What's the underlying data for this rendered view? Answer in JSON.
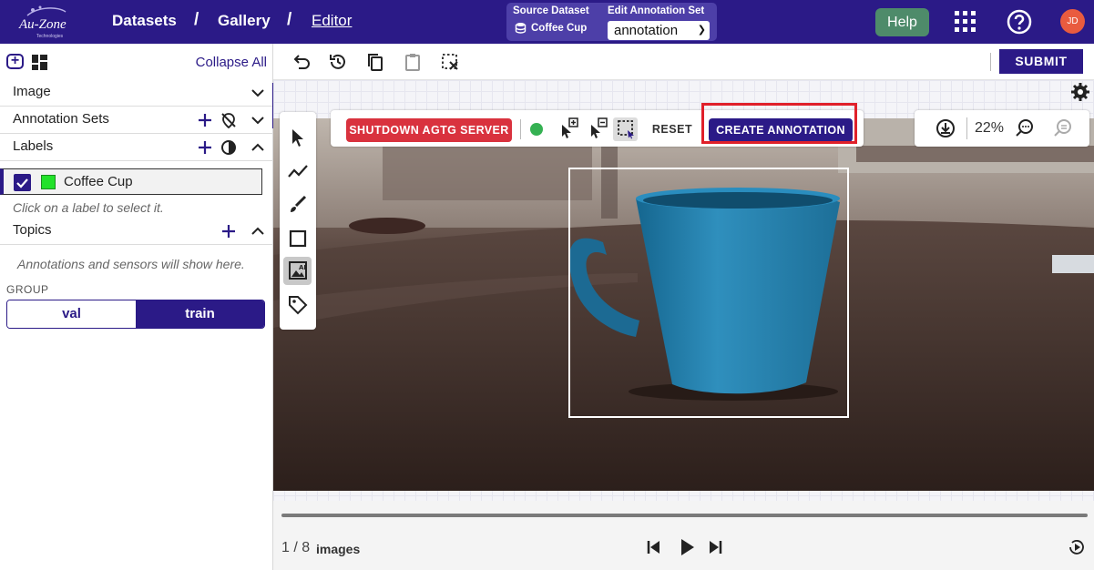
{
  "header": {
    "logo_text": "Au-Zone",
    "logo_sub": "Technologies",
    "breadcrumbs": [
      {
        "label": "Datasets"
      },
      {
        "label": "Gallery"
      },
      {
        "label": "Editor"
      }
    ],
    "separator": "/",
    "source_dataset_label": "Source Dataset",
    "source_dataset_value": "Coffee Cup",
    "edit_annotation_label": "Edit Annotation Set",
    "edit_annotation_value": "annotation",
    "help_label": "Help",
    "avatar_initials": "JD"
  },
  "left_panel": {
    "collapse_all": "Collapse All",
    "sections": {
      "image": "Image",
      "annotation_sets": "Annotation Sets",
      "labels": "Labels",
      "topics": "Topics"
    },
    "label_item": {
      "name": "Coffee Cup",
      "color": "#22e22a",
      "checked": true
    },
    "labels_hint": "Click on a label to select it.",
    "topics_hint": "Annotations and sensors will show here.",
    "group_label": "GROUP",
    "group_options": [
      "val",
      "train"
    ],
    "group_selected": "train"
  },
  "toolbar": {
    "submit_label": "SUBMIT"
  },
  "canvas": {
    "shutdown_label": "SHUTDOWN AGTG SERVER",
    "reset_label": "RESET",
    "create_label": "CREATE ANNOTATION",
    "zoom_level": "22%",
    "status_color": "#35b152"
  },
  "footer": {
    "page_indicator": "1 / 8",
    "images_label": "images"
  },
  "colors": {
    "brand": "#2b1a87",
    "danger": "#d9323e",
    "help": "#4e8b6a",
    "highlight": "#e0202a"
  }
}
